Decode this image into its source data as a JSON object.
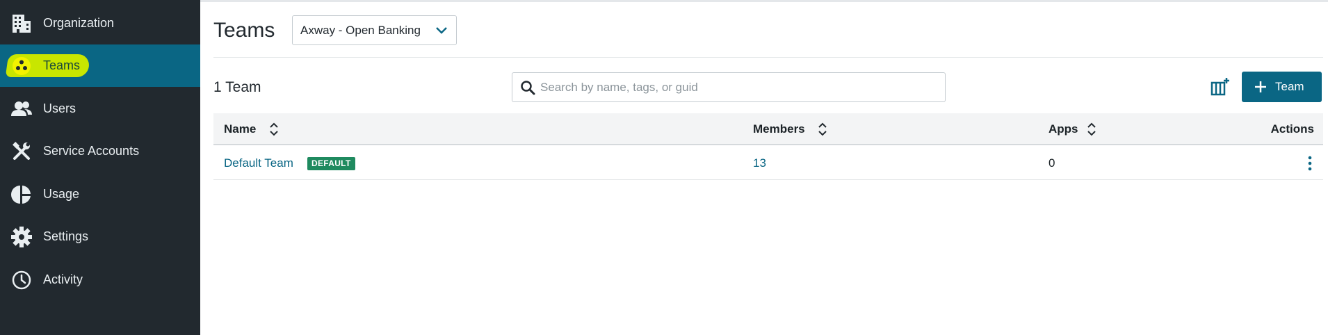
{
  "sidebar": {
    "items": [
      {
        "label": "Organization",
        "icon": "building-icon"
      },
      {
        "label": "Teams",
        "icon": "teams-icon",
        "active": true
      },
      {
        "label": "Users",
        "icon": "users-icon"
      },
      {
        "label": "Service Accounts",
        "icon": "tools-icon"
      },
      {
        "label": "Usage",
        "icon": "pie-chart-icon"
      },
      {
        "label": "Settings",
        "icon": "gear-icon"
      },
      {
        "label": "Activity",
        "icon": "clock-icon"
      }
    ]
  },
  "header": {
    "title": "Teams",
    "org_select": "Axway - Open Banking"
  },
  "toolbar": {
    "count_label": "1 Team",
    "search_placeholder": "Search by name, tags, or guid",
    "add_button_label": "Team"
  },
  "table": {
    "columns": [
      "Name",
      "Members",
      "Apps",
      "Actions"
    ],
    "rows": [
      {
        "name": "Default Team",
        "badge": "DEFAULT",
        "members": "13",
        "apps": "0"
      }
    ]
  },
  "colors": {
    "sidebar_bg": "#22292f",
    "accent": "#0a6684",
    "highlight": "#c8e600",
    "badge_green": "#1f8a5f"
  }
}
